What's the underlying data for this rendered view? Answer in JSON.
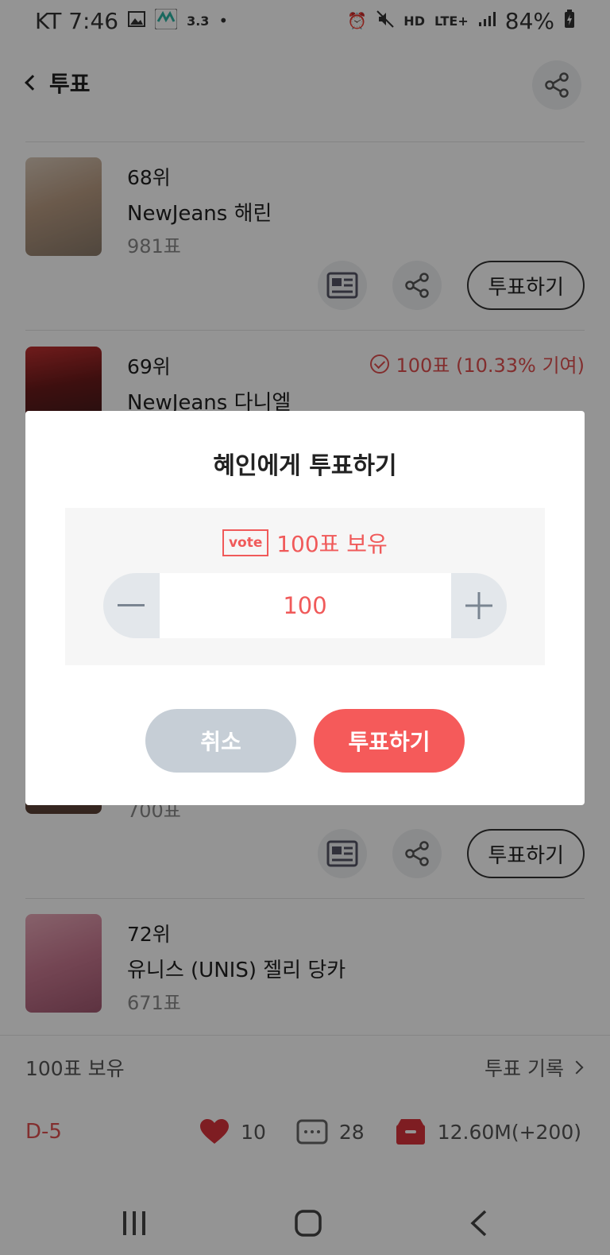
{
  "status": {
    "carrier_time": "KT 7:46",
    "small_badge": "3.3",
    "network": "LTE+",
    "battery": "84%"
  },
  "header": {
    "title": "투표"
  },
  "candidates": [
    {
      "rank": "68위",
      "name": "NewJeans 해린",
      "votes": "981표",
      "vote_label": "투표하기"
    },
    {
      "rank": "69위",
      "name": "NewJeans 다니엘",
      "contribution": "100표 (10.33% 기여)"
    },
    {
      "votes": "700표",
      "vote_label": "투표하기"
    },
    {
      "rank": "72위",
      "name": "유니스 (UNIS) 젤리 당카",
      "votes": "671표"
    }
  ],
  "dialog": {
    "title": "혜인에게 투표하기",
    "vote_tag": "vote",
    "owned": "100표 보유",
    "amount": "100",
    "cancel_label": "취소",
    "confirm_label": "투표하기"
  },
  "footer": {
    "owned": "100표 보유",
    "history_label": "투표 기록",
    "dday": "D-5",
    "likes": "10",
    "comments": "28",
    "total": "12.60M(+200)"
  },
  "colors": {
    "accent": "#f55a5a",
    "cancel": "#c6ced6"
  }
}
